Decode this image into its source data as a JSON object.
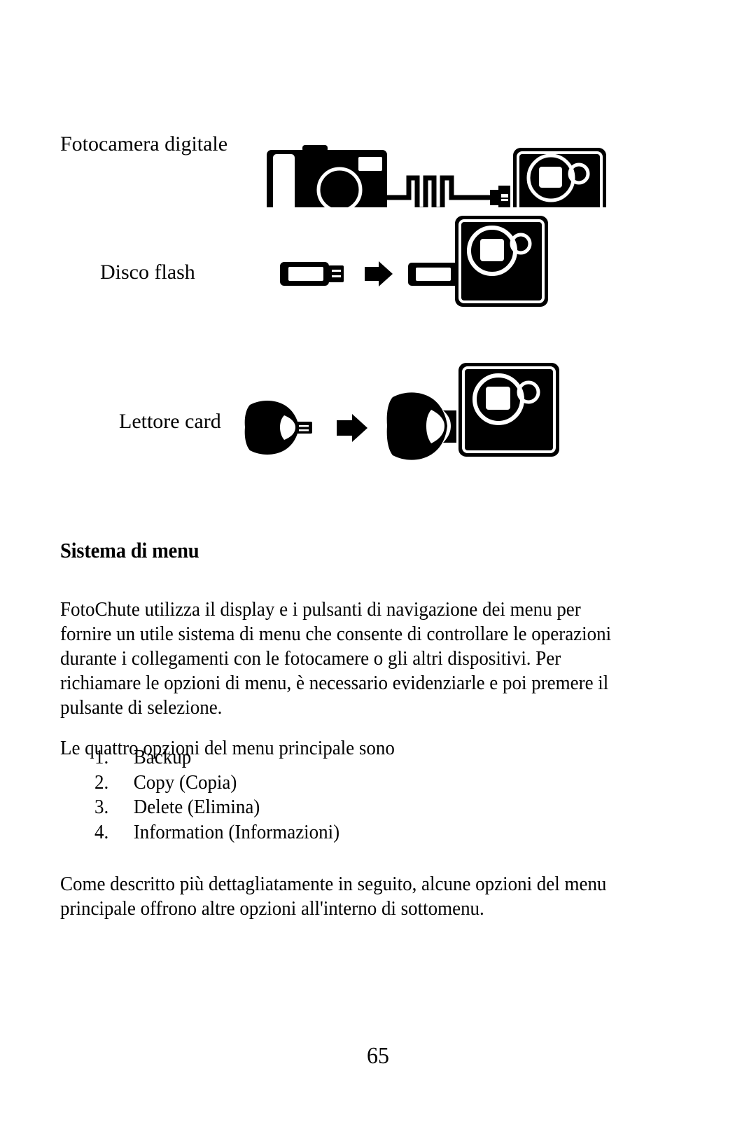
{
  "page": {
    "folio": "65"
  },
  "diagram": {
    "rows": [
      {
        "label": "Fotocamera digitale",
        "icons": [
          "digital-camera-icon",
          "usb-cable-icon",
          "fotochute-device-icon"
        ]
      },
      {
        "label": "Disco flash",
        "icons": [
          "flash-drive-icon",
          "right-arrow-icon",
          "fotochute-device-icon"
        ]
      },
      {
        "label": "Lettore card",
        "icons": [
          "card-reader-icon",
          "right-arrow-icon",
          "fotochute-device-icon"
        ]
      }
    ]
  },
  "section": {
    "heading": "Sistema di menu",
    "paragraph_1": "FotoChute utilizza il display e i pulsanti di navigazione dei menu per fornire un utile sistema di menu che consente di controllare le operazioni durante i collegamenti con le fotocamere o gli altri dispositivi. Per richiamare le opzioni di menu, è necessario evidenziarle e poi premere il pulsante di selezione.",
    "paragraph_2": "Le quattro opzioni del menu principale sono",
    "list": [
      {
        "num": "1.",
        "text": "Backup"
      },
      {
        "num": "2.",
        "text": "Copy (Copia)"
      },
      {
        "num": "3.",
        "text": "Delete (Elimina)"
      },
      {
        "num": "4.",
        "text": "Information (Informazioni)"
      }
    ],
    "paragraph_3": "Come descritto più dettagliatamente in seguito, alcune opzioni del menu principale offrono altre opzioni all'interno di sottomenu."
  },
  "colors": {
    "ink": "#000000",
    "paper": "#ffffff"
  }
}
